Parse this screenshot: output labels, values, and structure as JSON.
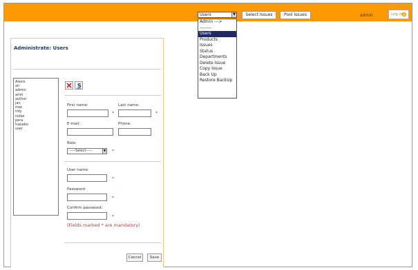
{
  "topbar": {
    "view_select": "Users",
    "select_issues_label": "Select Issues",
    "pool_issues_label": "Pool Issues",
    "user_name": "admin",
    "logoff_label": "Log off"
  },
  "dropdown": {
    "options": [
      "Admin --->",
      "--------",
      "Users",
      "Products",
      "Issues",
      "Status",
      "Departments",
      "Delete Issue",
      "Copy Issue",
      "Back Up",
      "Restore BackUp"
    ],
    "selected": "Users"
  },
  "panel": {
    "title": "Administrate: Users"
  },
  "users": [
    "Alexis",
    "ali",
    "admin",
    "amit",
    "author",
    "jan",
    "mac",
    "mfy",
    "nidas",
    "pera",
    "tuejabo",
    "user"
  ],
  "toolbar": {
    "delete_icon": "delete-x-icon",
    "save_icon": "save-s-icon",
    "delete_glyph": "X",
    "save_glyph": "S"
  },
  "form": {
    "first_name_label": "First name:",
    "last_name_label": "Last name:",
    "email_label": "E-mail:",
    "phone_label": "Phone:",
    "role_label": "Role:",
    "role_value": "-----Select-----",
    "username_label": "User name:",
    "password_label": "Password:",
    "confirm_password_label": "Confirm password:",
    "required_mark": "*",
    "mandatory_note": "(Fields marked * are mandatory)"
  },
  "buttons": {
    "cancel": "Cancel",
    "save": "Save"
  },
  "colors": {
    "topbar": "#ff9900",
    "selected_option": "#1e2b6b",
    "required": "#c03030",
    "panel_border": "#e0c98a"
  }
}
